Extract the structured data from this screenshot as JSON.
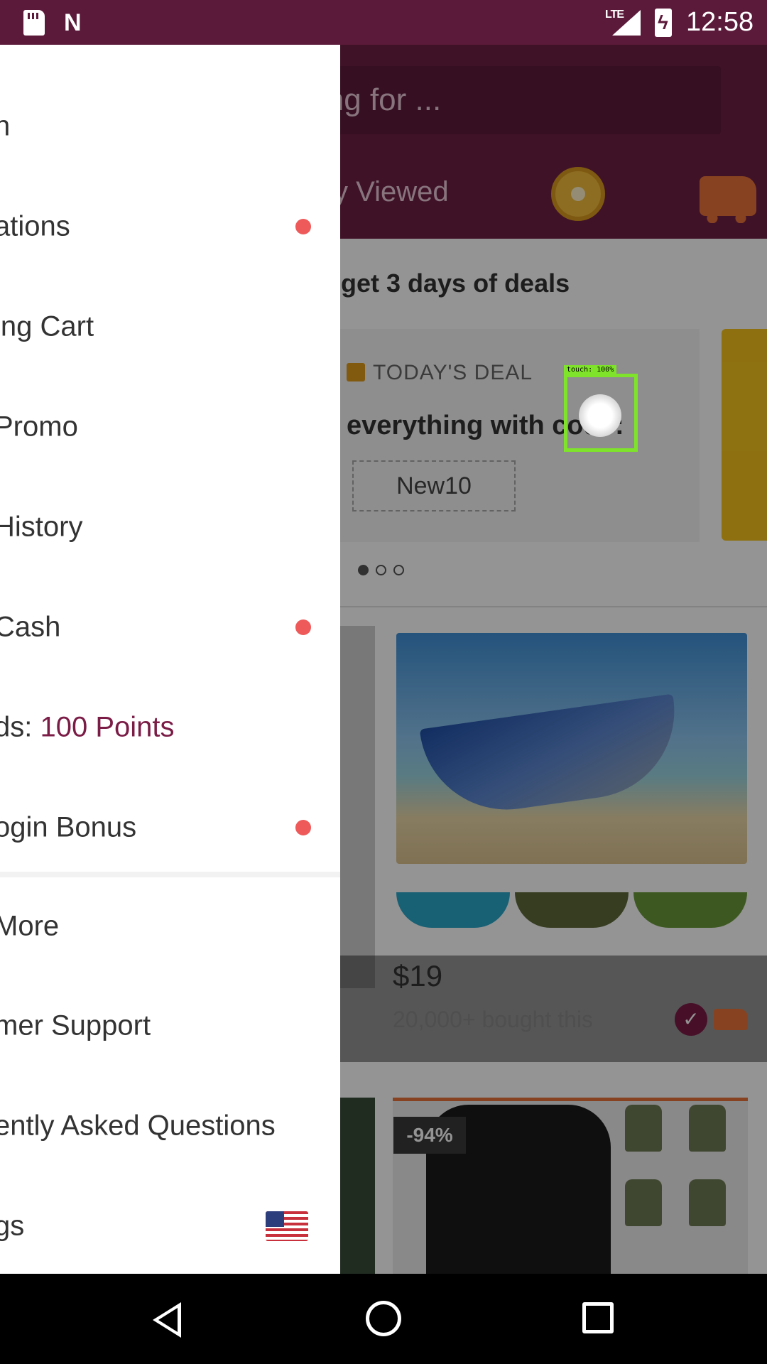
{
  "status_bar": {
    "time": "12:58",
    "network": "LTE",
    "icons": [
      "sd-card-icon",
      "n-notification-icon",
      "lte-signal-icon",
      "battery-charging-icon"
    ]
  },
  "app": {
    "search_placeholder": "ing for ...",
    "tab_label": "y Viewed",
    "deals_title": "get 3 days of deals",
    "deal_tag": "TODAY'S DEAL",
    "deal_text": "everything with code:",
    "deal_code": "New10",
    "product": {
      "price": "$19",
      "bought": "20,000+ bought this"
    },
    "second_product_badge": "-94%",
    "colors": {
      "brand": "#6e1f46",
      "accent": "#7a1c46",
      "notification_dot": "#ee5a5a",
      "ship_orange": "#e8743a"
    }
  },
  "drawer": {
    "items": [
      {
        "label": "n",
        "dot": false
      },
      {
        "label": "ations",
        "dot": true
      },
      {
        "label": "ing Cart",
        "dot": false
      },
      {
        "label": "Promo",
        "dot": false
      },
      {
        "label": "History",
        "dot": false
      },
      {
        "label": "Cash",
        "dot": true
      },
      {
        "label_prefix": "ds: ",
        "points": "100 Points",
        "dot": false
      },
      {
        "label": "ogin Bonus",
        "dot": true
      }
    ],
    "secondary_items": [
      {
        "label": "More"
      },
      {
        "label": "mer Support"
      },
      {
        "label": "ently Asked Questions"
      },
      {
        "label": "gs",
        "icon": "us-flag-icon"
      }
    ]
  },
  "touch_indicator": {
    "label": "touch: 100%"
  }
}
